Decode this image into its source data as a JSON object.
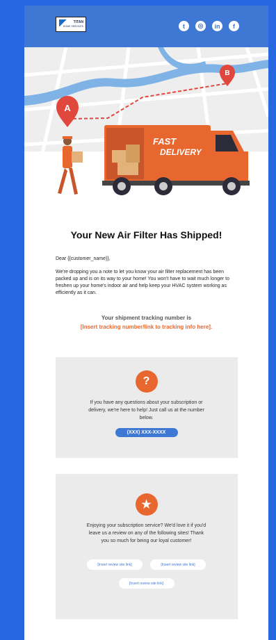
{
  "header": {
    "logo_name": "TITAN",
    "logo_sub": "HOME SERVICES",
    "social": [
      "twitter-icon",
      "instagram-icon",
      "linkedin-icon",
      "facebook-icon"
    ],
    "social_glyphs": [
      "t",
      "◎",
      "in",
      "f"
    ]
  },
  "hero": {
    "marker_a": "A",
    "marker_b": "B",
    "truck_text_1": "FAST",
    "truck_text_2": "DELIVERY"
  },
  "title": "Your New Air Filter Has Shipped!",
  "greeting": "Dear {{customer_name}},",
  "paragraph": "We're dropping you a note to let you know your air filter replacement has been packed up and is on its way to your home! You won't have to wait much longer to freshen up your home's indoor air and help keep your HVAC system working as efficiently as it can.",
  "tracking": {
    "label": "Your shipment tracking number is",
    "link": "[Insert tracking number/link to tracking info here]."
  },
  "help_card": {
    "icon_glyph": "?",
    "text": "If you have any questions about your subscription or delivery, we're here to help! Just call us at the number below.",
    "phone": "(XXX) XXX-XXXX"
  },
  "review_card": {
    "icon_glyph": "★",
    "text": "Enjoying your subscription service? We'd love it if you'd leave us a review on any of the following sites! Thank you so much for being our loyal customer!",
    "links": [
      "[Insert review site link]",
      "[Insert review site link]",
      "[Insert review site link]"
    ]
  },
  "colors": {
    "accent": "#e8672e",
    "brand": "#3f78d4",
    "background": "#2767e0"
  }
}
